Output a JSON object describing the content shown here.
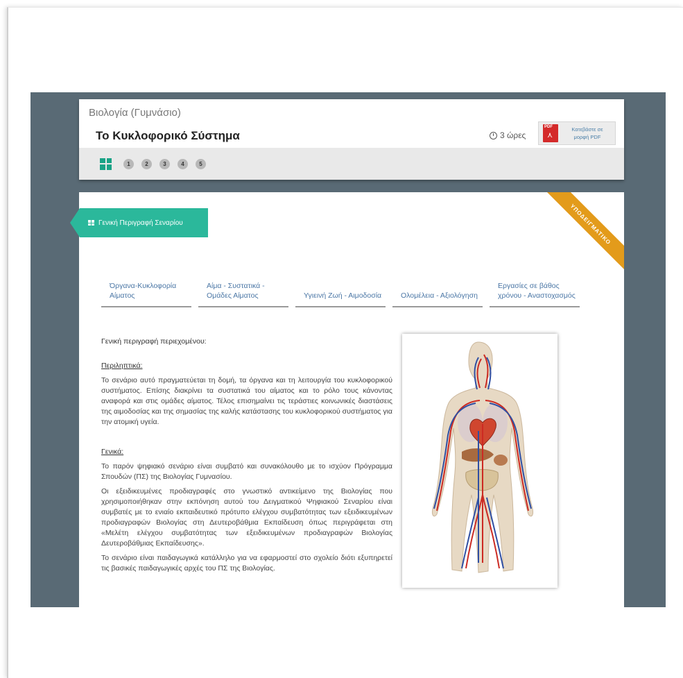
{
  "header": {
    "subject": "Βιολογία (Γυμνάσιο)",
    "title": "Το Κυκλοφορικό Σύστημα",
    "duration": "3 ώρες",
    "pdf_label": "Κατεβάστε σε μορφή PDF"
  },
  "steps": [
    "1",
    "2",
    "3",
    "4",
    "5"
  ],
  "ribbon": "ΥΠΟΔΕΙΓΜΑΤΙΚΟ",
  "section_button": "Γενική Περιγραφή Σεναρίου",
  "tabs": [
    "Όργανα-Κυκλοφορία Αίματος",
    "Αίμα - Συστατικά - Ομάδες Αίματος",
    "Υγιεινή Ζωή - Αιμοδοσία",
    "Ολομέλεια - Αξιολόγηση",
    "Εργασίες σε βάθος χρόνου - Αναστοχασμός"
  ],
  "article": {
    "heading": "Γενική περιγραφή περιεχομένου:",
    "summary_title": "Περιληπτικά:",
    "summary_text": "Το σενάριο αυτό πραγματεύεται τη δομή, τα όργανα και τη λειτουργία του κυκλοφορικού συστήματος. Επίσης διακρίνει τα συστατικά του αίματος και το ρόλο τους κάνοντας αναφορά και στις ομάδες αίματος. Τέλος επισημαίνει τις τεράστιες κοινωνικές διαστάσεις της αιμοδοσίας και της σημασίας της καλής κατάστασης του κυκλοφορικού συστήματος για την ατομική υγεία.",
    "general_title": "Γενικά:",
    "general_p1": "Το παρόν ψηφιακό σενάριο είναι συμβατό και συνακόλουθο με το ισχύον Πρόγραμμα Σπουδών (ΠΣ) της Βιολογίας Γυμνασίου.",
    "general_p2": "Οι εξειδικευμένες προδιαγραφές στο γνωστικό αντικείμενο της Βιολογίας που χρησιμοποιήθηκαν στην εκπόνηση αυτού του Δειγματικού Ψηφιακού Σεναρίου είναι συμβατές με το ενιαίο εκπαιδευτικό πρότυπο ελέγχου συμβατότητας των εξειδικευμένων προδιαγραφών Βιολογίας στη Δευτεροβάθμια Εκπαίδευση όπως περιγράφεται στη «Μελέτη ελέγχου συμβατότητας των εξειδικευμένων προδιαγραφών Βιολογίας Δευτεροβάθμιας Εκπαίδευσης».",
    "general_p3": "Το σενάριο είναι παιδαγωγικά κατάλληλο για να εφαρμοστεί στο σχολείο διότι εξυπηρετεί τις βασικές παιδαγωγικές αρχές του ΠΣ της Βιολογίας."
  },
  "colors": {
    "accent": "#2bb89b",
    "ribbon": "#e39b1b",
    "background": "#596a75",
    "link": "#4a76a5"
  }
}
